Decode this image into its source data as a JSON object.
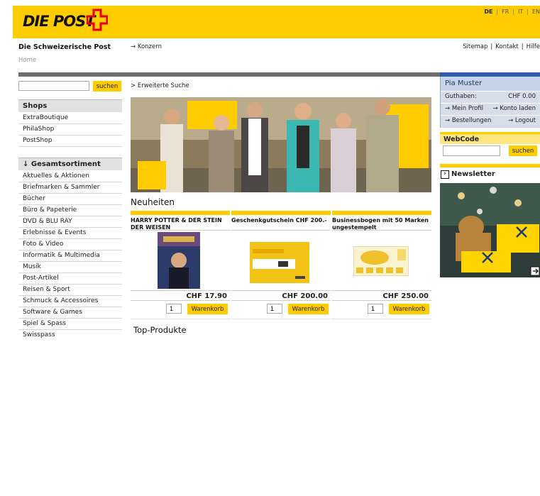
{
  "header": {
    "logo_text": "DIE POST",
    "languages": [
      "DE",
      "FR",
      "IT",
      "EN"
    ],
    "active_language": "DE"
  },
  "brand_line": "Die Schweizerische Post",
  "konzern_link": "→ Konzern",
  "top_nav": [
    "Sitemap",
    "Kontakt",
    "Hilfe"
  ],
  "breadcrumb": "Home",
  "search": {
    "button_label": "suchen",
    "value": ""
  },
  "shops": {
    "heading": "Shops",
    "items": [
      "ExtraBoutique",
      "PhilaShop",
      "PostShop"
    ]
  },
  "sortiment": {
    "heading": "↓ Gesamtsortiment",
    "items": [
      "Aktuelles & Aktionen",
      "Briefmarken & Sammler",
      "Bücher",
      "Büro & Papeterie",
      "DVD & BLU RAY",
      "Erlebnisse & Events",
      "Foto & Video",
      "Informatik & Multimedia",
      "Musik",
      "Post-Artikel",
      "Reisen & Sport",
      "Schmuck & Accessoires",
      "Software & Games",
      "Spiel & Spass",
      "Swisspass"
    ]
  },
  "main": {
    "extended_search": "> Erweiterte Suche",
    "neuheiten_heading": "Neuheiten",
    "top_products_heading": "Top-Produkte",
    "products": [
      {
        "title": "HARRY POTTER & DER STEIN DER WEISEN",
        "price": "CHF 17.90",
        "qty": "1",
        "cart_label": "Warenkorb"
      },
      {
        "title": "Geschenkgutschein CHF 200.-",
        "price": "CHF 200.00",
        "qty": "1",
        "cart_label": "Warenkorb"
      },
      {
        "title": "Businessbogen mit 50 Marken ungestempelt",
        "price": "CHF 250.00",
        "qty": "1",
        "cart_label": "Warenkorb"
      }
    ]
  },
  "user": {
    "name": "Pia Muster",
    "balance_label": "Guthaben:",
    "balance_value": "CHF 0.00",
    "profile_link": "→ Mein Profil",
    "topup_link": "→ Konto laden",
    "orders_link": "→ Bestellungen",
    "logout_link": "→ Logout"
  },
  "webcode": {
    "heading": "WebCode",
    "button_label": "suchen",
    "value": ""
  },
  "newsletter": {
    "heading": "Newsletter"
  },
  "colors": {
    "brand_yellow": "#ffcc00",
    "brand_red": "#e2001a",
    "nav_blue": "#2b5da8"
  }
}
